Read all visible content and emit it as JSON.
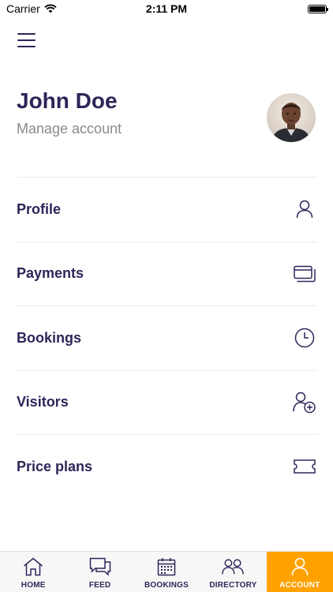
{
  "status_bar": {
    "carrier": "Carrier",
    "time": "2:11 PM"
  },
  "header": {
    "name": "John Doe",
    "subtitle": "Manage account"
  },
  "menu": [
    {
      "label": "Profile",
      "icon": "user-icon"
    },
    {
      "label": "Payments",
      "icon": "cards-icon"
    },
    {
      "label": "Bookings",
      "icon": "clock-icon"
    },
    {
      "label": "Visitors",
      "icon": "add-user-icon"
    },
    {
      "label": "Price plans",
      "icon": "ticket-icon"
    }
  ],
  "tabs": [
    {
      "label": "HOME",
      "icon": "home-icon"
    },
    {
      "label": "FEED",
      "icon": "chat-icon"
    },
    {
      "label": "BOOKINGS",
      "icon": "calendar-icon"
    },
    {
      "label": "DIRECTORY",
      "icon": "people-icon"
    },
    {
      "label": "ACCOUNT",
      "icon": "user-icon",
      "active": true
    }
  ],
  "colors": {
    "primary": "#2b2658",
    "accent": "#ffa200",
    "muted": "#8a8a8a",
    "divider": "#ececec"
  }
}
